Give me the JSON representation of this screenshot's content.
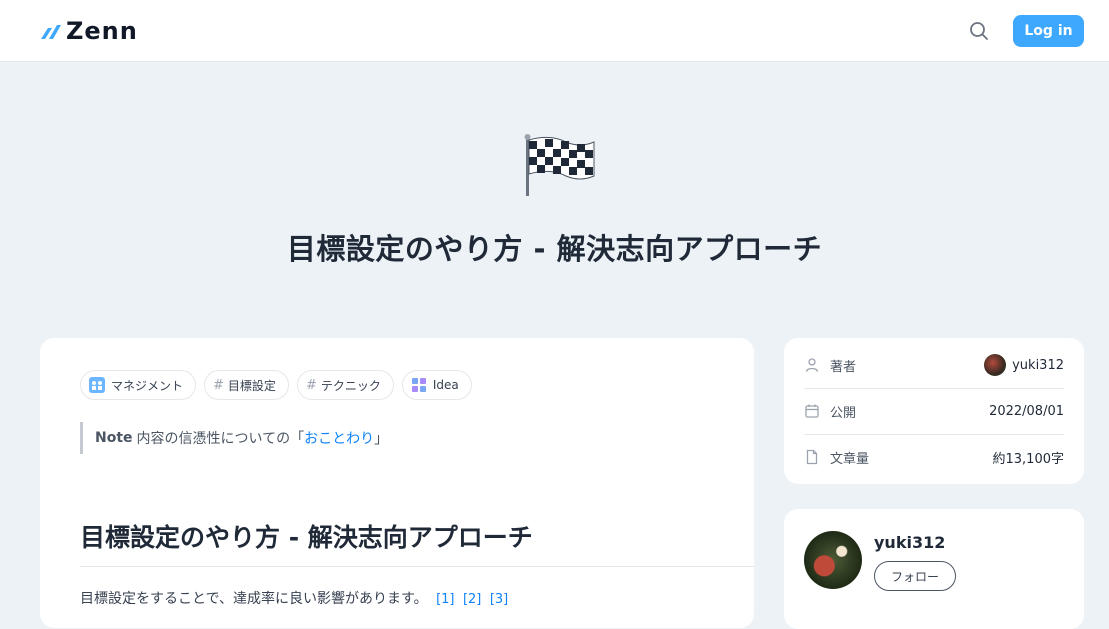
{
  "header": {
    "logo_text": "Zenn",
    "login_label": "Log in"
  },
  "hero": {
    "emoji": "checkered-flag",
    "title": "目標設定のやり方 - 解決志向アプローチ"
  },
  "article": {
    "topics": [
      {
        "label": "マネジメント",
        "icon": "management-topic-icon"
      },
      {
        "label": "目標設定",
        "icon": "hash"
      },
      {
        "label": "テクニック",
        "icon": "hash"
      },
      {
        "label": "Idea",
        "icon": "idea-topic-icon"
      }
    ],
    "note": {
      "label": "Note",
      "text_before": "内容の信憑性についての「",
      "link": "おことわり",
      "text_after": "」"
    },
    "heading": "目標設定のやり方 - 解決志向アプローチ",
    "paragraph": "目標設定をすることで、達成率に良い影響があります。",
    "footnotes": [
      "[1]",
      "[2]",
      "[3]"
    ]
  },
  "info": {
    "author_label": "著者",
    "author_value": "yuki312",
    "published_label": "公開",
    "published_value": "2022/08/01",
    "length_label": "文章量",
    "length_value": "約13,100字"
  },
  "author_card": {
    "name": "yuki312",
    "follow_label": "フォロー"
  },
  "colors": {
    "accent": "#3ea8ff",
    "link": "#0f83fd",
    "background": "#edf2f7"
  }
}
